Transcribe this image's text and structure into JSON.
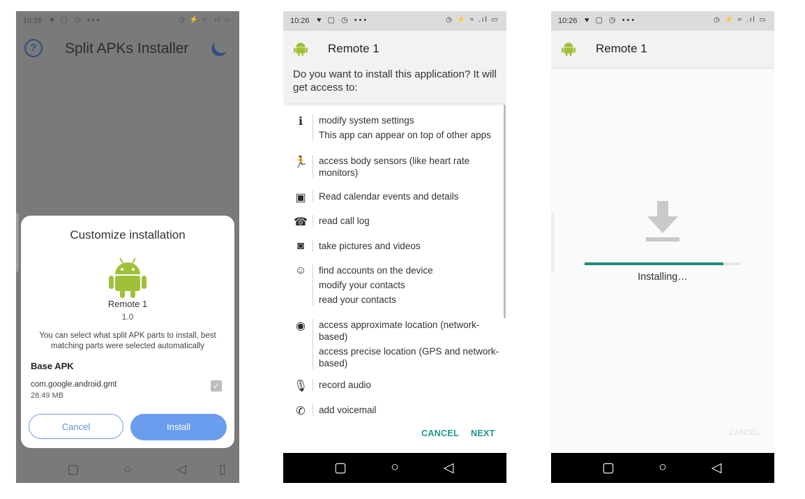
{
  "screen1": {
    "status_time": "10:26",
    "status_left_icons": "♥ ▢ ◷ •••",
    "status_right_icons": "◷ ⚡ ≈ .ıl ▭",
    "app_title": "Split APKs Installer",
    "dialog": {
      "title": "Customize installation",
      "app_name": "Remote 1",
      "version": "1.0",
      "description": "You can select what split APK parts to install, best matching parts were selected automatically",
      "section_title": "Base APK",
      "package_name": "com.google.android.gmt",
      "package_size": "28.49 MB",
      "cancel_label": "Cancel",
      "install_label": "Install"
    }
  },
  "screen2": {
    "status_time": "10:26",
    "status_left_icons": "♥ ▢ ◷ •••",
    "status_right_icons": "◷ ⚡ ≈ .ıl ▭",
    "app_name": "Remote 1",
    "question": "Do you want to install this application? It will get access to:",
    "permissions": [
      {
        "icon": "phone-info-icon",
        "glyph": "ℹ",
        "lines": [
          "modify system settings",
          "This app can appear on top of other apps"
        ]
      },
      {
        "icon": "run-icon",
        "glyph": "🏃",
        "lines": [
          "access body sensors (like heart rate monitors)"
        ]
      },
      {
        "icon": "calendar-icon",
        "glyph": "▣",
        "lines": [
          "Read calendar events and details"
        ]
      },
      {
        "icon": "call-log-icon",
        "glyph": "☎",
        "lines": [
          "read call log"
        ]
      },
      {
        "icon": "camera-icon",
        "glyph": "◙",
        "lines": [
          "take pictures and videos"
        ]
      },
      {
        "icon": "contacts-icon",
        "glyph": "☺",
        "lines": [
          "find accounts on the device",
          "modify your contacts",
          "read your contacts"
        ]
      },
      {
        "icon": "location-icon",
        "glyph": "◉",
        "lines": [
          "access approximate location (network-based)",
          "access precise location (GPS and network-based)"
        ]
      },
      {
        "icon": "microphone-icon",
        "glyph": "🎙",
        "lines": [
          "record audio"
        ]
      },
      {
        "icon": "voicemail-icon",
        "glyph": "✆",
        "lines": [
          "add voicemail"
        ]
      }
    ],
    "cancel_label": "CANCEL",
    "next_label": "NEXT"
  },
  "screen3": {
    "status_time": "10:26",
    "status_left_icons": "♥ ▢ ◷ •••",
    "status_right_icons": "◷ ⚡ ≈ .ıl ▭",
    "app_name": "Remote 1",
    "progress_percent": 89,
    "status_text": "Installing…",
    "cancel_label": "CANCEL"
  },
  "colors": {
    "android_green": "#9fc139",
    "accent_teal": "#1f8a7c",
    "install_blue": "#6a9ded",
    "dim_overlay": "#7a7a7a"
  }
}
